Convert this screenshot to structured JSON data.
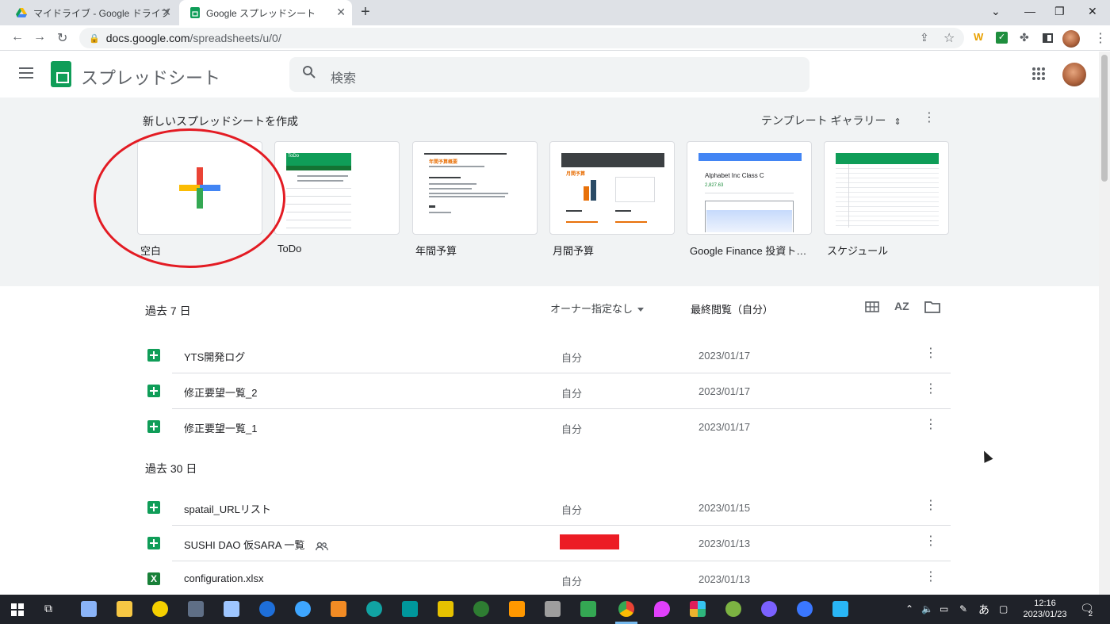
{
  "browser": {
    "tabs": [
      {
        "title": "マイドライブ - Google ドライブ",
        "icon": "google-drive-icon"
      },
      {
        "title": "Google スプレッドシート",
        "icon": "google-sheets-icon"
      }
    ],
    "url_host": "docs.google.com",
    "url_path": "/spreadsheets/u/0/",
    "new_tab_label": "+",
    "ext_w_label": "W"
  },
  "header": {
    "app_title": "スプレッドシート",
    "search_placeholder": "検索"
  },
  "templates": {
    "heading": "新しいスプレッドシートを作成",
    "gallery_label": "テンプレート ギャラリー",
    "cards": [
      {
        "label": "空白"
      },
      {
        "label": "ToDo"
      },
      {
        "label": "年間予算"
      },
      {
        "label": "月間予算"
      },
      {
        "label": "Google Finance 投資ト…"
      },
      {
        "label": "スケジュール"
      }
    ],
    "mini": {
      "todo_title": "ToDo",
      "annual_title": "年間予算概要",
      "finance_title": "Alphabet Inc Class C",
      "finance_price": "2,827.63",
      "monthly_title": "月間予算"
    }
  },
  "list": {
    "header_title": "過去 7 日",
    "owner_filter": "オーナー指定なし",
    "sort_label": "最終閲覧（自分）",
    "sort_icon_label": "AZ",
    "sections": [
      {
        "title": "過去 7 日",
        "rows": [
          {
            "name": "YTS開発ログ",
            "owner": "自分",
            "date": "2023/01/17"
          },
          {
            "name": "修正要望一覧_2",
            "owner": "自分",
            "date": "2023/01/17"
          },
          {
            "name": "修正要望一覧_1",
            "owner": "自分",
            "date": "2023/01/17"
          }
        ]
      },
      {
        "title": "過去 30 日",
        "rows": [
          {
            "name": "spatail_URLリスト",
            "owner": "自分",
            "date": "2023/01/15"
          },
          {
            "name": "SUSHI DAO 仮SARA 一覧",
            "owner": "",
            "date": "2023/01/13"
          },
          {
            "name": "configuration.xlsx",
            "owner": "自分",
            "date": "2023/01/13"
          }
        ]
      }
    ]
  },
  "taskbar": {
    "time": "12:16",
    "date": "2023/01/23",
    "ime": "あ",
    "notifications": "2"
  },
  "colors": {
    "sheets_green": "#0f9d58",
    "annotation_red": "#e31b23",
    "redaction_red": "#ec1c24"
  }
}
